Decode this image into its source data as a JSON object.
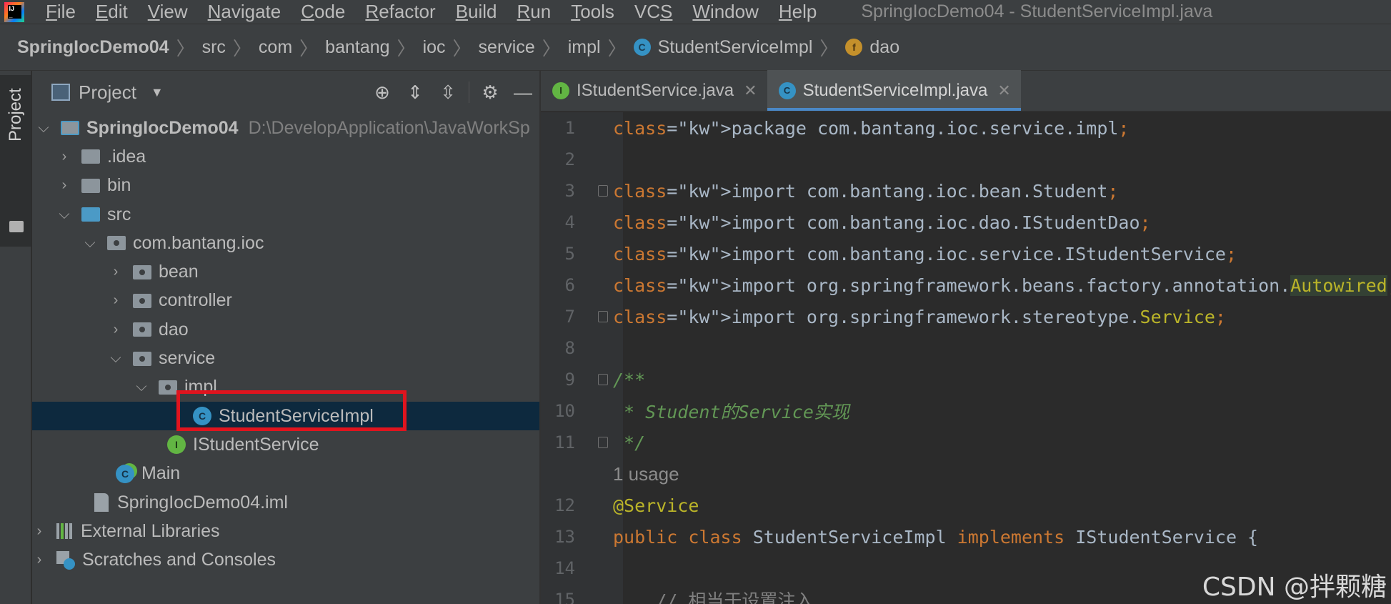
{
  "menu": {
    "items": [
      "File",
      "Edit",
      "View",
      "Navigate",
      "Code",
      "Refactor",
      "Build",
      "Run",
      "Tools",
      "VCS",
      "Window",
      "Help"
    ],
    "mnemonics": [
      "F",
      "E",
      "V",
      "N",
      "C",
      "R",
      "B",
      "R",
      "T",
      "S",
      "W",
      "H"
    ],
    "window_title": "SpringIocDemo04 - StudentServiceImpl.java"
  },
  "breadcrumb": [
    "SpringIocDemo04",
    "src",
    "com",
    "bantang",
    "ioc",
    "service",
    "impl",
    "StudentServiceImpl",
    "dao"
  ],
  "toolstrip": {
    "project_label": "Project"
  },
  "project_panel": {
    "title": "Project",
    "tree": [
      {
        "label": "SpringIocDemo04",
        "path": "D:\\DevelopApplication\\JavaWorkSp",
        "bold": true
      },
      {
        "label": ".idea"
      },
      {
        "label": "bin"
      },
      {
        "label": "src"
      },
      {
        "label": "com.bantang.ioc"
      },
      {
        "label": "bean"
      },
      {
        "label": "controller"
      },
      {
        "label": "dao"
      },
      {
        "label": "service"
      },
      {
        "label": "impl"
      },
      {
        "label": "StudentServiceImpl"
      },
      {
        "label": "IStudentService"
      },
      {
        "label": "Main"
      },
      {
        "label": "SpringIocDemo04.iml"
      },
      {
        "label": "External Libraries"
      },
      {
        "label": "Scratches and Consoles"
      }
    ]
  },
  "editor": {
    "tabs": [
      {
        "label": "IStudentService.java",
        "icon": "I",
        "active": false
      },
      {
        "label": "StudentServiceImpl.java",
        "icon": "C",
        "active": true
      }
    ],
    "lines": [
      {
        "num": "1",
        "code": "package com.bantang.ioc.service.impl;"
      },
      {
        "num": "2",
        "code": ""
      },
      {
        "num": "3",
        "code": "import com.bantang.ioc.bean.Student;"
      },
      {
        "num": "4",
        "code": "import com.bantang.ioc.dao.IStudentDao;"
      },
      {
        "num": "5",
        "code": "import com.bantang.ioc.service.IStudentService;"
      },
      {
        "num": "6",
        "code": "import org.springframework.beans.factory.annotation.Autowired;"
      },
      {
        "num": "7",
        "code": "import org.springframework.stereotype.Service;"
      },
      {
        "num": "8",
        "code": ""
      },
      {
        "num": "9",
        "code": "/**"
      },
      {
        "num": "10",
        "code": " * Student的Service实现"
      },
      {
        "num": "11",
        "code": " */"
      },
      {
        "num": "",
        "code": "1 usage"
      },
      {
        "num": "12",
        "code": "@Service"
      },
      {
        "num": "13",
        "code": "public class StudentServiceImpl implements IStudentService {"
      },
      {
        "num": "14",
        "code": ""
      },
      {
        "num": "15",
        "code": "    // 相当于设置注入"
      }
    ]
  },
  "watermark": "CSDN @拌颗糖",
  "colors": {
    "keyword": "#cc7832",
    "annotation": "#bbb529",
    "comment": "#629755",
    "selection": "#0d293e",
    "highlight_border": "#e0141e"
  }
}
